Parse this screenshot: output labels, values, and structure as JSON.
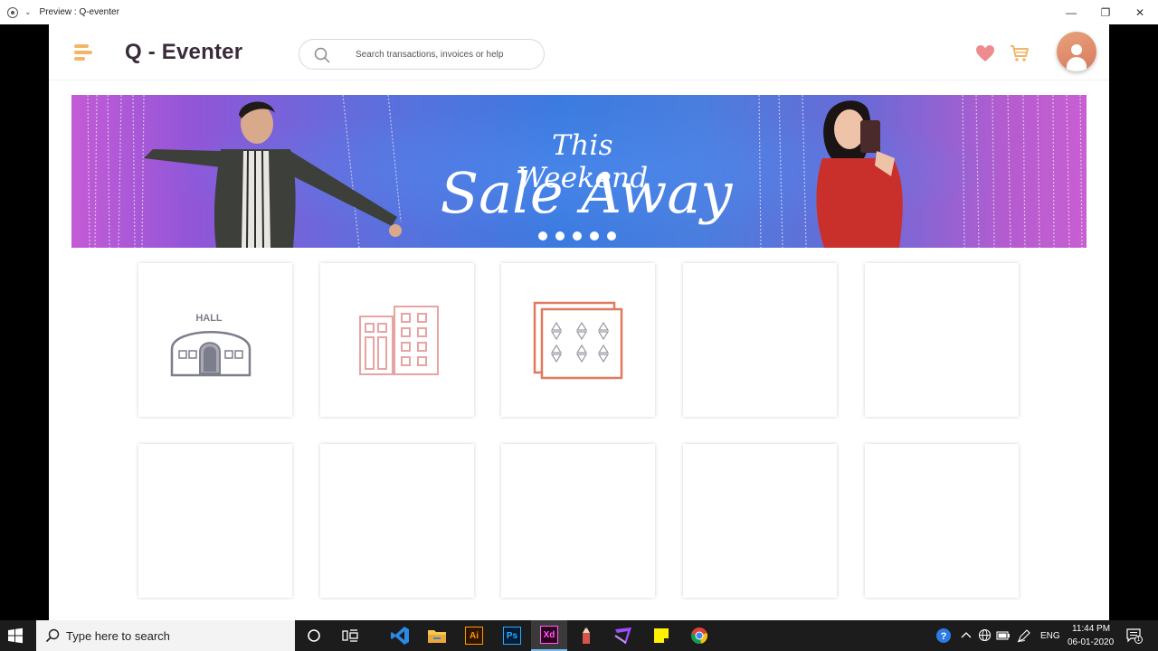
{
  "window": {
    "title": "Preview : Q-eventer",
    "chevron": "⌄",
    "minimize": "—",
    "maximize": "❐",
    "close": "✕"
  },
  "header": {
    "brand": "Q - Eventer",
    "search_placeholder": "Search transactions, invoices or help",
    "menu_icon": "hamburger-menu-icon",
    "wishlist_icon": "heart-icon",
    "cart_icon": "shopping-cart-icon",
    "avatar_icon": "user-avatar-icon"
  },
  "banner": {
    "line1": "This Weekend",
    "line2": "Sale Away",
    "slides": 5,
    "active_slide": 1
  },
  "cards": [
    {
      "icon": "hall-icon",
      "label": "HALL"
    },
    {
      "icon": "buildings-icon"
    },
    {
      "icon": "seating-icon"
    },
    {
      "icon": ""
    },
    {
      "icon": ""
    },
    {
      "icon": ""
    },
    {
      "icon": ""
    },
    {
      "icon": ""
    },
    {
      "icon": ""
    },
    {
      "icon": ""
    }
  ],
  "taskbar": {
    "search_placeholder": "Type here to search",
    "apps": [
      "cortana-icon",
      "task-view-icon",
      "vscode-icon",
      "file-explorer-icon",
      "illustrator-icon",
      "photoshop-icon",
      "adobe-xd-icon",
      "pencil-app-icon",
      "visual-studio-icon",
      "sticky-notes-icon",
      "chrome-icon"
    ],
    "app_labels": {
      "illustrator": "Ai",
      "photoshop": "Ps",
      "xd": "Xd"
    },
    "language": "ENG",
    "time": "11:44 PM",
    "date": "06-01-2020",
    "notification_count": "1"
  },
  "colors": {
    "accent_orange": "#f5b569",
    "heart_pink": "#ee8b8f",
    "brand_text": "#3b2a3a",
    "card_icon_gray": "#7d7e8c",
    "card_icon_pink": "#e8a3a3",
    "card_icon_coral": "#e07a5f"
  }
}
